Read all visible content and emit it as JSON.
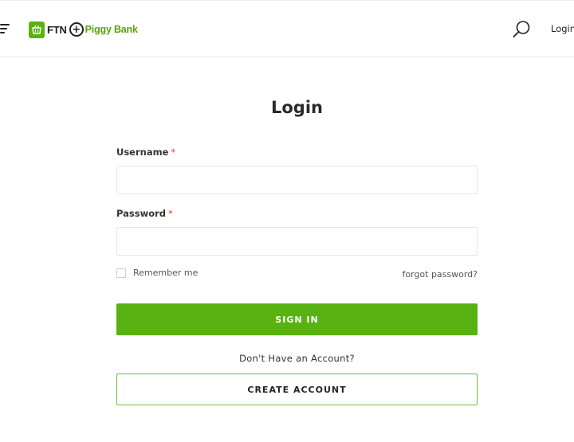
{
  "header": {
    "menu_icon": "hamburger-menu-icon",
    "logo": {
      "mark": "FTN",
      "name": "Piggy Bank",
      "basket_icon": "shopping-basket-icon"
    },
    "search_icon": "search-icon",
    "login_link": "Login"
  },
  "form": {
    "title": "Login",
    "username": {
      "label": "Username",
      "required_mark": "*",
      "value": ""
    },
    "password": {
      "label": "Password",
      "required_mark": "*",
      "value": ""
    },
    "remember_me": {
      "label": "Remember me",
      "checked": false
    },
    "forgot_password": "forgot password?",
    "sign_in_button": "SIGN IN",
    "no_account_text": "Don't Have an Account?",
    "create_account_button": "CREATE ACCOUNT"
  },
  "colors": {
    "accent": "#58b212",
    "required": "#e2401c"
  }
}
